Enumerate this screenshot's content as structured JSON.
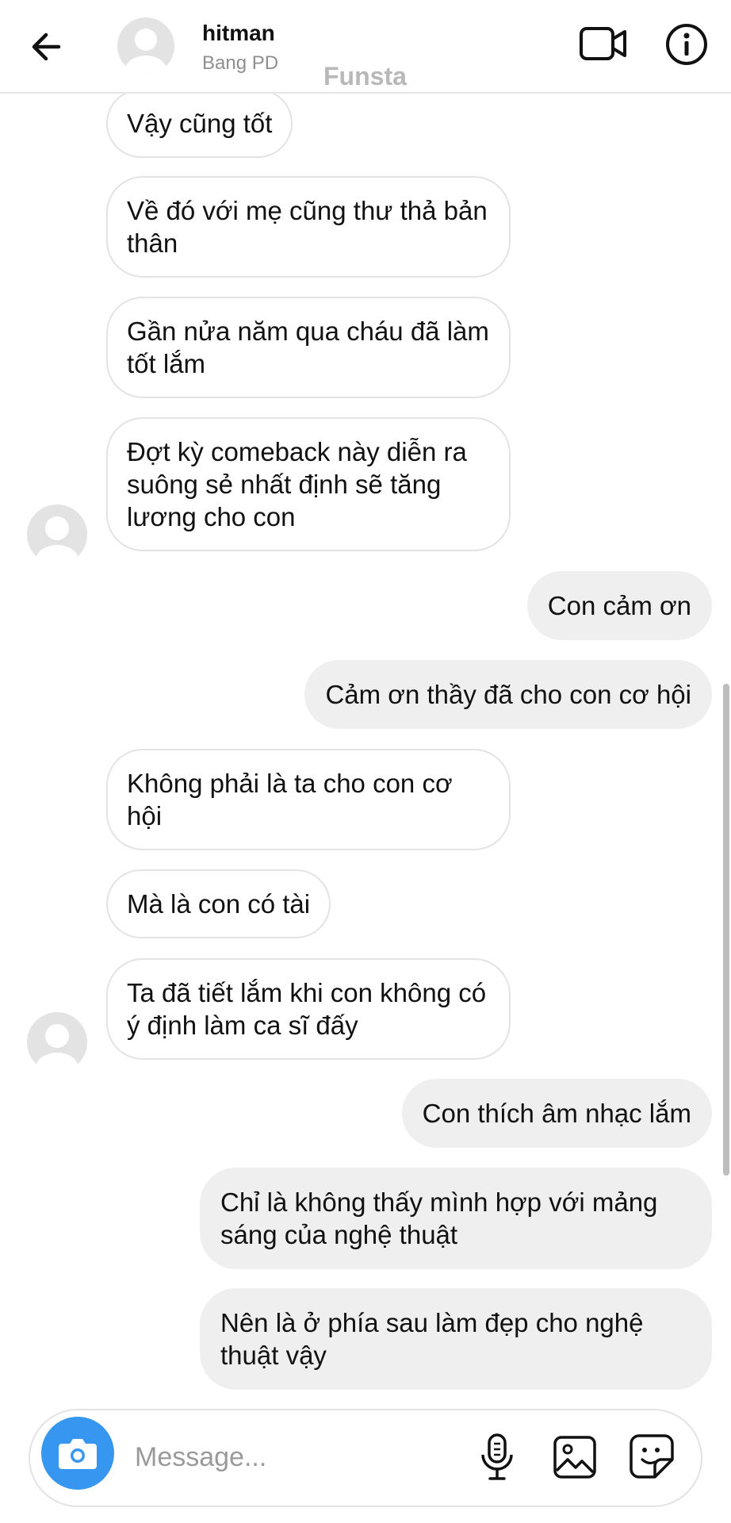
{
  "header": {
    "back_icon": "arrow-left-icon",
    "contact_name": "hitman",
    "contact_subtitle": "Bang PD",
    "watermark": "Funsta",
    "video_icon": "video-camera-icon",
    "info_icon": "info-icon"
  },
  "messages": [
    {
      "direction": "incoming",
      "text": "Vậy cũng tốt"
    },
    {
      "direction": "incoming",
      "text": "Về đó với mẹ cũng thư thả bản thân"
    },
    {
      "direction": "incoming",
      "text": "Gần nửa năm qua cháu đã làm tốt lắm"
    },
    {
      "direction": "incoming",
      "text": "Đợt kỳ comeback này diễn ra suông sẻ nhất định sẽ tăng lương cho con"
    },
    {
      "direction": "outgoing",
      "text": "Con cảm ơn"
    },
    {
      "direction": "outgoing",
      "text": "Cảm ơn thầy đã cho con cơ hội"
    },
    {
      "direction": "incoming",
      "text": "Không phải là ta cho con cơ hội"
    },
    {
      "direction": "incoming",
      "text": "Mà là con có tài"
    },
    {
      "direction": "incoming",
      "text": "Ta đã tiết lắm khi con không có ý định làm ca sĩ đấy"
    },
    {
      "direction": "outgoing",
      "text": "Con thích âm nhạc lắm"
    },
    {
      "direction": "outgoing",
      "text": "Chỉ là không thấy mình hợp với mảng sáng của nghệ thuật"
    },
    {
      "direction": "outgoing",
      "text": "Nên là ở phía sau làm đẹp cho nghệ thuật vậy"
    }
  ],
  "composer": {
    "placeholder": "Message...",
    "camera_icon": "camera-icon",
    "mic_icon": "microphone-icon",
    "gallery_icon": "image-gallery-icon",
    "sticker_icon": "sticker-icon"
  },
  "colors": {
    "camera_button": "#3797f0",
    "outgoing_bubble": "#efefef",
    "incoming_border": "#e3e3e3"
  }
}
